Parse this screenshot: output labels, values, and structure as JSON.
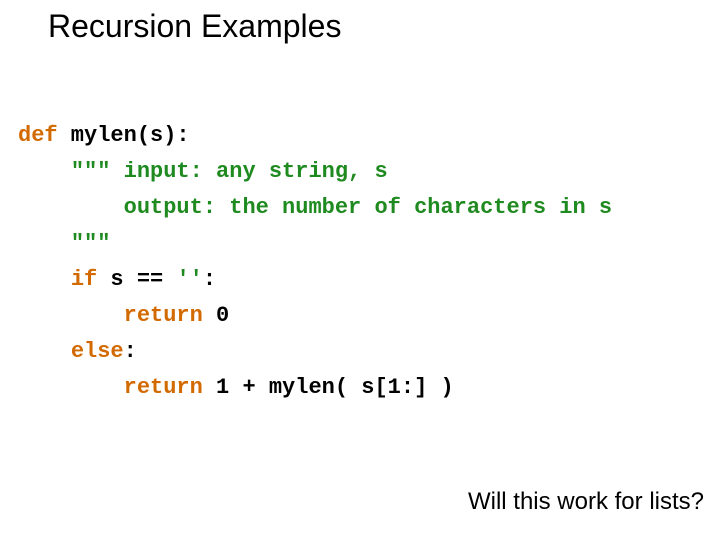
{
  "title": "Recursion Examples",
  "code": {
    "l1": {
      "kw_def": "def",
      "rest": " mylen(s):"
    },
    "l2": {
      "indent": "    ",
      "triplequote": "\"\"\"",
      "rest": " input: any string, s"
    },
    "l3": {
      "indent": "        ",
      "rest": "output: the number of characters in s"
    },
    "l4": {
      "indent": "    ",
      "triplequote": "\"\"\""
    },
    "l5": {
      "indent": "    ",
      "kw_if": "if",
      "mid": " s == ",
      "str_empty": "''",
      "colon": ":"
    },
    "l6": {
      "indent": "        ",
      "kw_return": "return",
      "rest": " 0"
    },
    "l7": {
      "indent": "    ",
      "kw_else": "else",
      "colon": ":"
    },
    "l8": {
      "indent": "        ",
      "kw_return": "return",
      "rest": " 1 + mylen( s[1:] )"
    }
  },
  "question": "Will this work for lists?"
}
